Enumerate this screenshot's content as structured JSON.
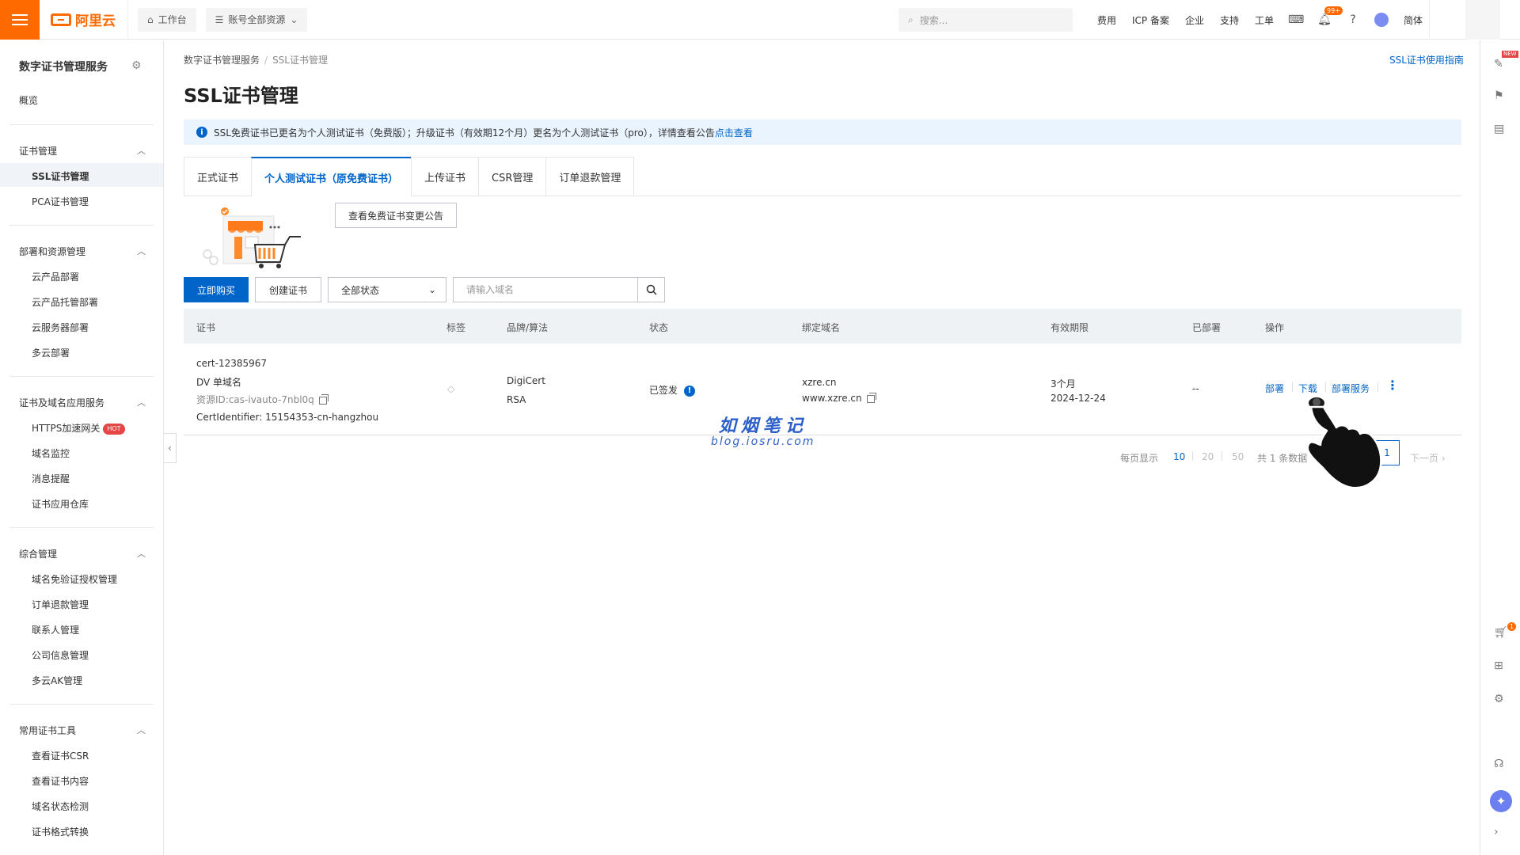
{
  "topbar": {
    "logo_text": "阿里云",
    "workbench": "工作台",
    "resources": "账号全部资源",
    "search_placeholder": "搜索...",
    "nav": [
      "费用",
      "ICP 备案",
      "企业",
      "支持",
      "工单"
    ],
    "message_badge": "99+",
    "lang": "简体"
  },
  "sidebar": {
    "title": "数字证书管理服务",
    "overview": "概览",
    "groups": [
      {
        "label": "证书管理",
        "items": [
          "SSL证书管理",
          "PCA证书管理"
        ]
      },
      {
        "label": "部署和资源管理",
        "items": [
          "云产品部署",
          "云产品托管部署",
          "云服务器部署",
          "多云部署"
        ]
      },
      {
        "label": "证书及域名应用服务",
        "items": [
          "HTTPS加速网关",
          "域名监控",
          "消息提醒",
          "证书应用仓库"
        ]
      },
      {
        "label": "综合管理",
        "items": [
          "域名免验证授权管理",
          "订单退款管理",
          "联系人管理",
          "公司信息管理",
          "多云AK管理"
        ]
      },
      {
        "label": "常用证书工具",
        "items": [
          "查看证书CSR",
          "查看证书内容",
          "域名状态检测",
          "证书格式转换"
        ]
      }
    ],
    "hot_badge": "HOT"
  },
  "main": {
    "breadcrumb": [
      "数字证书管理服务",
      "SSL证书管理"
    ],
    "guide_link": "SSL证书使用指南",
    "title": "SSL证书管理",
    "notice_text": "SSL免费证书已更名为个人测试证书（免费版）；升级证书（有效期12个月）更名为个人测试证书（pro），详情查看公告",
    "notice_link": "点击查看",
    "tabs": [
      "正式证书",
      "个人测试证书（原免费证书）",
      "上传证书",
      "CSR管理",
      "订单退款管理"
    ],
    "announce_button": "查看免费证书变更公告",
    "buy_button": "立即购买",
    "create_button": "创建证书",
    "status_select": "全部状态",
    "domain_placeholder": "请输入域名",
    "table": {
      "headers": [
        "证书",
        "标签",
        "品牌/算法",
        "状态",
        "绑定域名",
        "有效期限",
        "已部署",
        "操作"
      ],
      "rows": [
        {
          "cert_id": "cert-12385967",
          "cert_type": "DV 单域名",
          "resource_id": "资源ID:cas-ivauto-7nbl0q",
          "identifier": "CertIdentifier: 15154353-cn-hangzhou",
          "brand": "DigiCert",
          "algorithm": "RSA",
          "status": "已签发",
          "domain1": "xzre.cn",
          "domain2": "www.xzre.cn",
          "validity": "3个月",
          "expire": "2024-12-24",
          "deployed": "--",
          "ops": [
            "部署",
            "下载",
            "部署服务"
          ]
        }
      ]
    },
    "pager": {
      "per_page_label": "每页显示",
      "sizes": [
        "10",
        "20",
        "50"
      ],
      "total": "共 1 条数据",
      "current_page": "1",
      "next": "下一页"
    }
  },
  "watermark": {
    "cn": "如烟笔记",
    "en": "blog.iosru.com"
  },
  "rail": {
    "new_badge": "NEW",
    "cart_badge": "1"
  }
}
